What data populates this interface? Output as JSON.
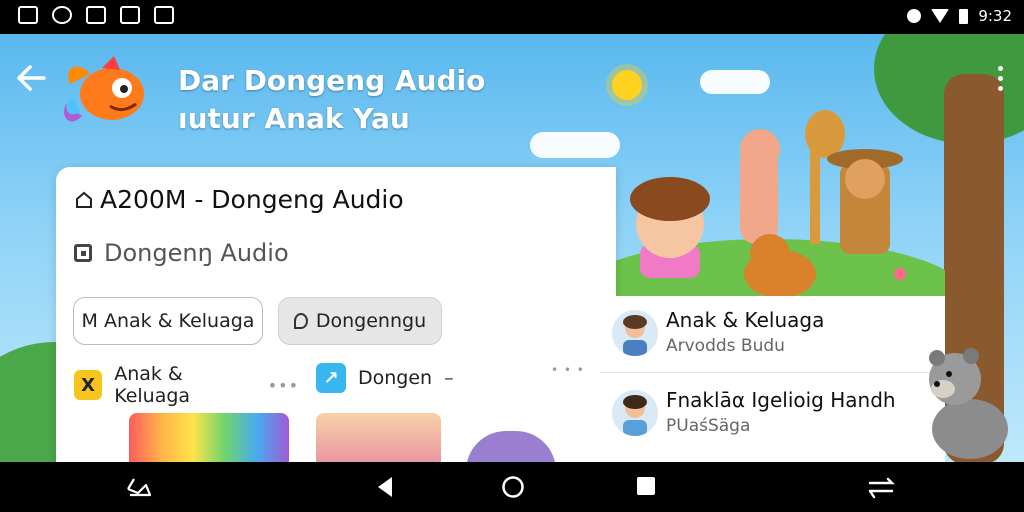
{
  "status_bar": {
    "time": "9:32",
    "left_icons": [
      "infinity-icon",
      "settings-icon",
      "message-icon",
      "sim-icon",
      "image-icon"
    ],
    "right_icons": [
      "alarm-icon",
      "wifi-icon",
      "battery-icon"
    ]
  },
  "header": {
    "title_line1": "Dar Dongeng Audio",
    "title_line2": "ıutur Anak Yau"
  },
  "card": {
    "title": "A200M - Dongeng Audio",
    "subtitle": "Dongenŋ Audio",
    "chips": [
      "M Anak & Keluaga",
      "Dongenngu"
    ],
    "subcards": [
      {
        "label": "Anak & Keluaga",
        "badge": "X",
        "badge_color": "#f7c51e"
      },
      {
        "label": "Dongen",
        "badge": "↗",
        "badge_color": "#37b6f0"
      }
    ]
  },
  "list": [
    {
      "title": "Anak & Keluaga",
      "subtitle": "Arvodds Budu"
    },
    {
      "title": "Fnaklāα Igelioig Handh",
      "subtitle": "PUaśSäga"
    }
  ],
  "colors": {
    "sky_top": "#5ab8ee",
    "sky_bottom": "#bfe8fb",
    "grass": "#4aa84a",
    "tree_trunk": "#8a5a2e",
    "sun": "#ffd21f"
  },
  "nav": [
    "back-nav-icon",
    "home-nav-icon",
    "recents-nav-icon",
    "screen-rotate-icon"
  ]
}
